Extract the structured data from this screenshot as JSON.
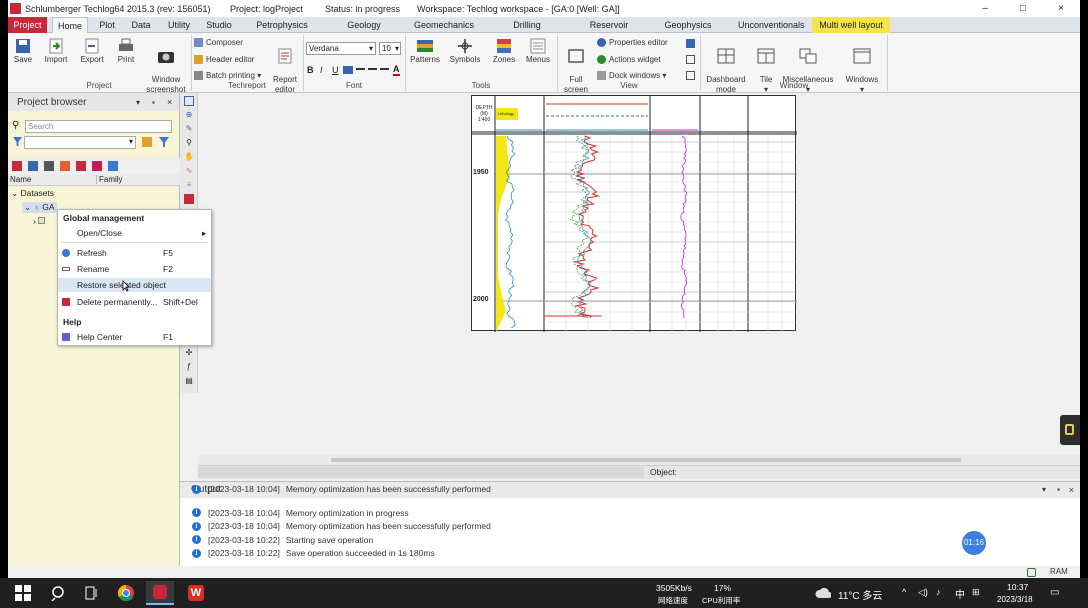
{
  "title_bar": {
    "app": "Schlumberger Techlog64 2015.3 (rev: 156051)",
    "project": "Project: logProject",
    "status": "Status: in progress",
    "workspace": "Workspace: Techlog workspace - [GA:0 [Well: GA]]",
    "buttons": [
      "–",
      "□",
      "×"
    ]
  },
  "tabs": [
    "Project",
    "Home",
    "Plot",
    "Data",
    "Utility",
    "Studio",
    "Petrophysics",
    "Geology",
    "Geomechanics",
    "Drilling",
    "Reservoir",
    "Geophysics",
    "Unconventionals",
    "Multi well layout"
  ],
  "ribbon": {
    "project_buttons": [
      "Save",
      "Import",
      "Export",
      "Print",
      "Window\nscreenshot"
    ],
    "project_group": "Project",
    "composer": "Composer",
    "header_editor": "Header editor",
    "batch_printing": "Batch printing ▾",
    "report_editor": "Report\neditor",
    "techreport_group": "Techreport",
    "font_name": "Verdana",
    "font_size": "10",
    "font_group": "Font",
    "font_style_btns": [
      "B",
      "I",
      "U"
    ],
    "tools_buttons": [
      "Patterns",
      "Symbols",
      "Zones",
      "Menus"
    ],
    "tools_group": "Tools",
    "full_screen": "Full\nscreen",
    "properties_editor": "Properties editor",
    "actions_widget": "Actions widget",
    "dock_windows": "Dock windows ▾",
    "view_group": "View",
    "window_buttons": [
      "Dashboard\nmode",
      "Tile\n▾",
      "Miscellaneous\n▾",
      "Windows\n▾"
    ],
    "window_group": "Window"
  },
  "project_browser": {
    "title": "Project browser",
    "search_placeholder": "Search",
    "col_name": "Name",
    "col_family": "Family",
    "tree": [
      "Datasets",
      "GA"
    ]
  },
  "context_menu": {
    "sections": [
      {
        "header": "Global management"
      },
      {
        "label": "Open/Close",
        "key": "▸"
      },
      {
        "label": "Refresh",
        "key": "F5",
        "icon": "refresh-icon"
      },
      {
        "label": "Rename",
        "key": "F2",
        "icon": "rename-icon"
      },
      {
        "label": "Restore selected object",
        "key": "",
        "highlight": true
      },
      {
        "label": "Delete permanently...",
        "key": "Shift+Del",
        "icon": "delete-icon"
      },
      {
        "header": "Help"
      },
      {
        "label": "Help Center",
        "key": "F1",
        "icon": "help-icon"
      }
    ]
  },
  "log_plot": {
    "depth_header": "DEPTH\n(M)\n1:400",
    "depth_ticks": [
      "1950",
      "2000"
    ],
    "track1_label": "Lithology",
    "track2_label": "",
    "colors": {
      "gr": "#f2e614",
      "curve_red": "#e03020",
      "curve_blue": "#2a8fc8",
      "curve_magenta": "#d020c8",
      "curve_green": "#2a8a2a"
    }
  },
  "status": {
    "object_label": "Object:"
  },
  "output": {
    "title": "Output",
    "lines": [
      {
        "time": "[2023-03-18 10:04]",
        "msg": "Memory optimization has been successfully performed"
      },
      {
        "time": "[2023-03-18 10:04]",
        "msg": "Memory optimization in progress"
      },
      {
        "time": "[2023-03-18 10:04]",
        "msg": "Memory optimization has been successfully performed"
      },
      {
        "time": "[2023-03-18 10:22]",
        "msg": "Starting save operation"
      },
      {
        "time": "[2023-03-18 10:22]",
        "msg": "Save operation succeeded in 1s 180ms"
      }
    ]
  },
  "overlay_timer": "01:16",
  "taskbar": {
    "net_speed": "3505Kb/s",
    "net_label": "网络速度",
    "cpu_pct": "17%",
    "cpu_label": "CPU利用率",
    "weather": "11°C 多云",
    "ime": "中",
    "time": "10:37",
    "date": "2023/3/18",
    "ram": "RAM"
  }
}
